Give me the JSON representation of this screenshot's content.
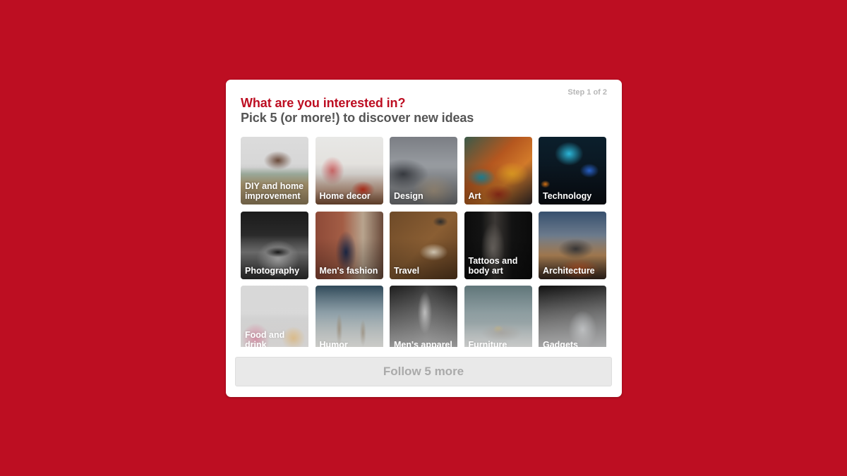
{
  "modal": {
    "step": "Step 1 of 2",
    "title": "What are you interested in?",
    "subtitle": "Pick 5 (or more!) to discover new ideas",
    "topics": [
      {
        "label": "DIY and home improvement",
        "image": "diy"
      },
      {
        "label": "Home decor",
        "image": "home"
      },
      {
        "label": "Design",
        "image": "design"
      },
      {
        "label": "Art",
        "image": "art"
      },
      {
        "label": "Technology",
        "image": "tech"
      },
      {
        "label": "Photography",
        "image": "photo"
      },
      {
        "label": "Men's fashion",
        "image": "menfash"
      },
      {
        "label": "Travel",
        "image": "travel"
      },
      {
        "label": "Tattoos and body art",
        "image": "tattoo"
      },
      {
        "label": "Architecture",
        "image": "arch"
      },
      {
        "label": "Food and drink",
        "image": "food"
      },
      {
        "label": "Humor",
        "image": "humor"
      },
      {
        "label": "Men's apparel",
        "image": "menapp"
      },
      {
        "label": "Furniture",
        "image": "furn"
      },
      {
        "label": "Gadgets",
        "image": "gadget"
      }
    ],
    "follow_button": "Follow 5 more"
  },
  "colors": {
    "brand": "#bd0e22",
    "subtitle": "#555555",
    "button_bg": "#e9e9e9",
    "button_text": "#aaaaaa"
  }
}
